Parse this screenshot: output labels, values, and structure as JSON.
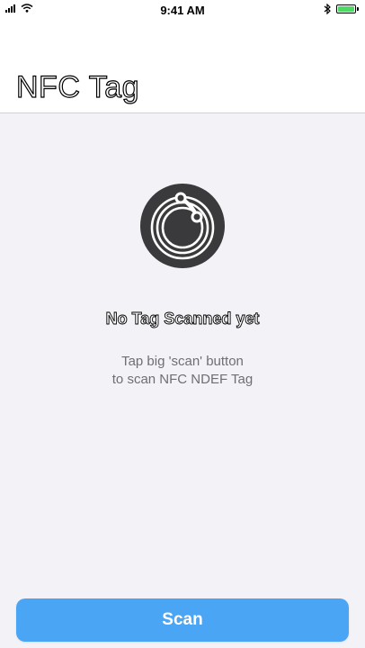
{
  "status_bar": {
    "time": "9:41 AM",
    "carrier": "",
    "battery_level": 1.0,
    "icons": [
      "signal-icon",
      "wifi-icon",
      "bluetooth-icon",
      "battery-icon"
    ]
  },
  "nav": {
    "title": "NFC Tag"
  },
  "empty_state": {
    "icon": "nfc-tag-icon",
    "title": "No Tag Scanned yet",
    "subtitle_line1": "Tap big 'scan' button",
    "subtitle_line2": "to scan NFC NDEF Tag"
  },
  "scan_button": {
    "label": "Scan"
  },
  "colors": {
    "accent": "#4aa6f5",
    "background": "#f2f2f7",
    "icon": "#3a3a3c",
    "battery": "#4cd964"
  }
}
